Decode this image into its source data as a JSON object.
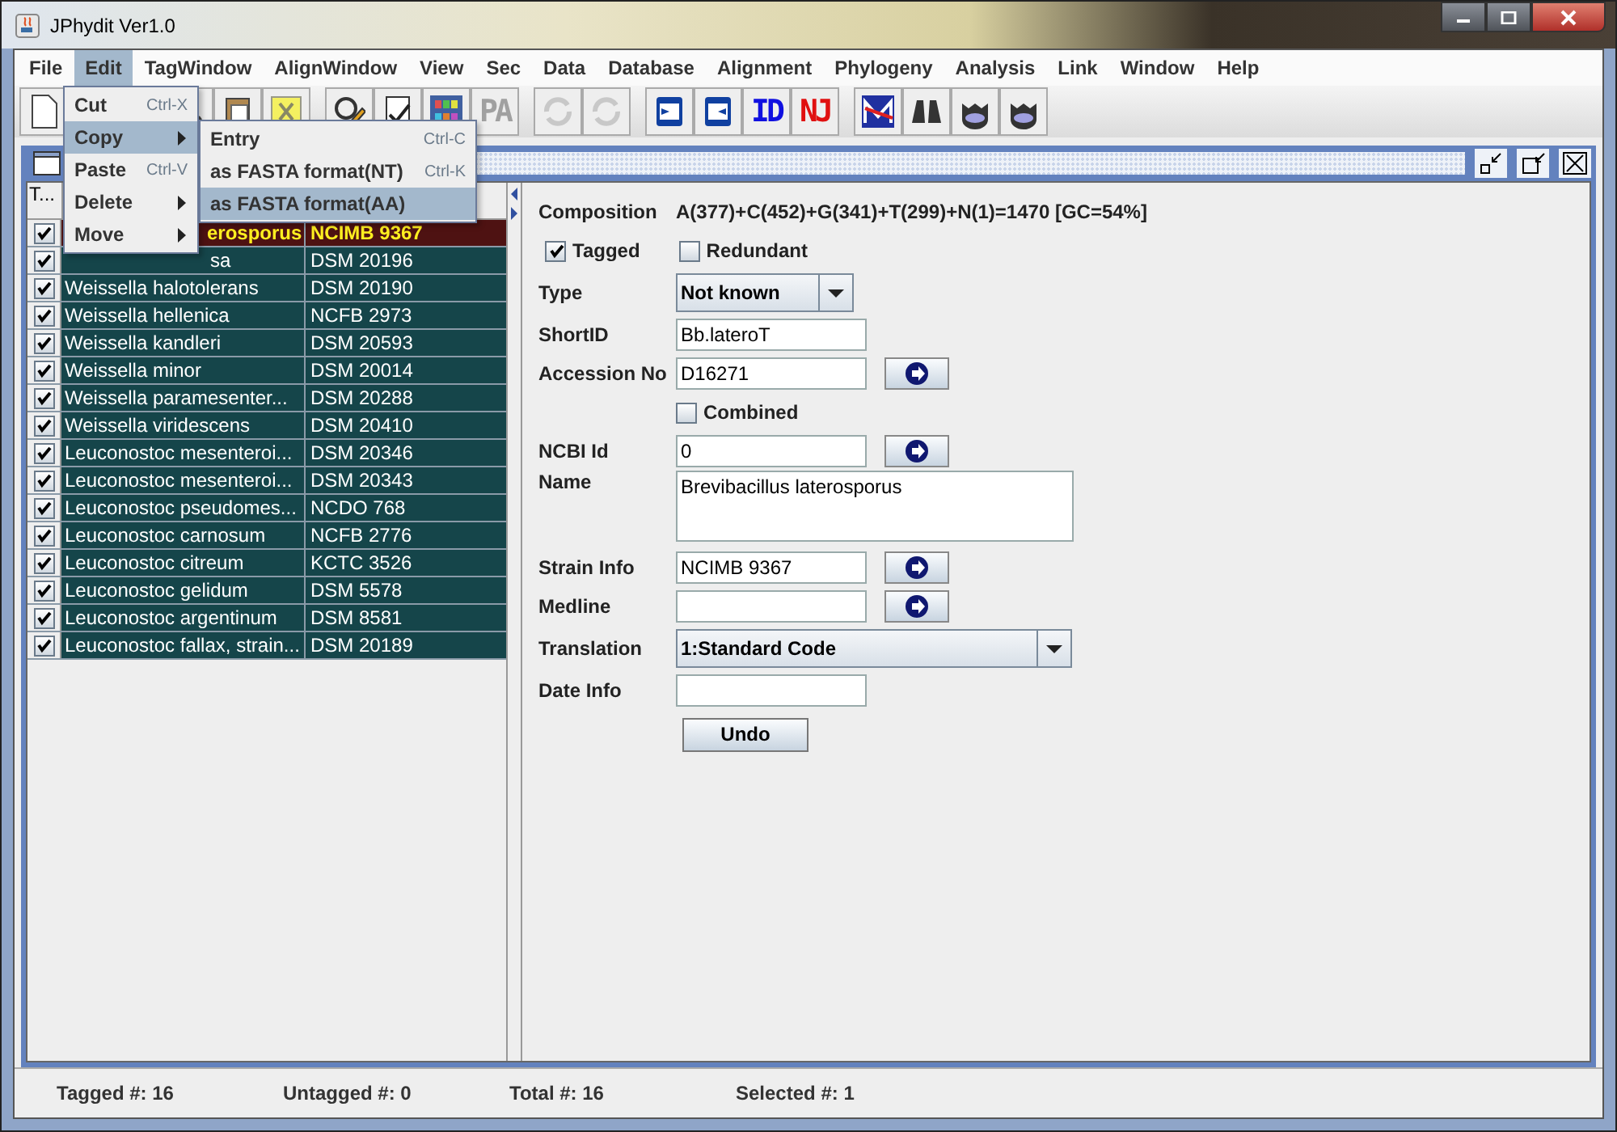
{
  "window": {
    "title": "JPhydit Ver1.0"
  },
  "menu": [
    {
      "label": "File",
      "selected": false
    },
    {
      "label": "Edit",
      "selected": true
    },
    {
      "label": "TagWindow",
      "selected": false
    },
    {
      "label": "AlignWindow",
      "selected": false
    },
    {
      "label": "View",
      "selected": false
    },
    {
      "label": "Sec",
      "selected": false
    },
    {
      "label": "Data",
      "selected": false
    },
    {
      "label": "Database",
      "selected": false
    },
    {
      "label": "Alignment",
      "selected": false
    },
    {
      "label": "Phylogeny",
      "selected": false
    },
    {
      "label": "Analysis",
      "selected": false
    },
    {
      "label": "Link",
      "selected": false
    },
    {
      "label": "Window",
      "selected": false
    },
    {
      "label": "Help",
      "selected": false
    }
  ],
  "edit_menu": [
    {
      "label": "Cut",
      "shortcut": "Ctrl-X",
      "submenu": false,
      "selected": false
    },
    {
      "label": "Copy",
      "submenu": true,
      "selected": true
    },
    {
      "label": "Paste",
      "shortcut": "Ctrl-V",
      "submenu": false,
      "selected": false
    },
    {
      "label": "Delete",
      "submenu": true,
      "selected": false
    },
    {
      "label": "Move",
      "submenu": true,
      "selected": false
    }
  ],
  "copy_submenu": [
    {
      "label": "Entry",
      "shortcut": "Ctrl-C",
      "selected": false
    },
    {
      "label": "as FASTA format(NT)",
      "shortcut": "Ctrl-K",
      "selected": false
    },
    {
      "label": "as FASTA format(AA)",
      "selected": true
    }
  ],
  "toolbar": [
    {
      "kind": "page"
    },
    {
      "kind": "scissors"
    },
    {
      "kind": "clipboard"
    },
    {
      "kind": "note"
    },
    {
      "kind": "edit"
    },
    {
      "kind": "tag"
    },
    {
      "kind": "grid"
    },
    {
      "kind": "text",
      "text": "PA",
      "color": "#a0a0a0"
    },
    {
      "kind": "refresh"
    },
    {
      "kind": "refresh"
    },
    {
      "kind": "import"
    },
    {
      "kind": "export"
    },
    {
      "kind": "text",
      "text": "ID",
      "color": "#1010e0"
    },
    {
      "kind": "text",
      "text": "NJ",
      "color": "#e01010"
    },
    {
      "kind": "chart"
    },
    {
      "kind": "binoculars"
    },
    {
      "kind": "face"
    },
    {
      "kind": "face"
    }
  ],
  "table": {
    "columns": [
      "T..."
    ],
    "rows": [
      {
        "tagged": true,
        "selected": true,
        "name": "erosporus",
        "id": "NCIMB 9367"
      },
      {
        "tagged": true,
        "selected": false,
        "name": "sa",
        "id": "DSM 20196"
      },
      {
        "tagged": true,
        "selected": false,
        "name": "Weissella halotolerans",
        "id": "DSM 20190"
      },
      {
        "tagged": true,
        "selected": false,
        "name": "Weissella hellenica",
        "id": "NCFB 2973"
      },
      {
        "tagged": true,
        "selected": false,
        "name": "Weissella kandleri",
        "id": "DSM 20593"
      },
      {
        "tagged": true,
        "selected": false,
        "name": "Weissella minor",
        "id": "DSM 20014"
      },
      {
        "tagged": true,
        "selected": false,
        "name": "Weissella paramesenter...",
        "id": "DSM 20288"
      },
      {
        "tagged": true,
        "selected": false,
        "name": "Weissella viridescens",
        "id": "DSM 20410"
      },
      {
        "tagged": true,
        "selected": false,
        "name": "Leuconostoc mesenteroi...",
        "id": "DSM 20346"
      },
      {
        "tagged": true,
        "selected": false,
        "name": "Leuconostoc mesenteroi...",
        "id": "DSM 20343"
      },
      {
        "tagged": true,
        "selected": false,
        "name": "Leuconostoc pseudomes...",
        "id": "NCDO 768"
      },
      {
        "tagged": true,
        "selected": false,
        "name": "Leuconostoc carnosum",
        "id": "NCFB 2776"
      },
      {
        "tagged": true,
        "selected": false,
        "name": "Leuconostoc citreum",
        "id": "KCTC 3526"
      },
      {
        "tagged": true,
        "selected": false,
        "name": "Leuconostoc gelidum",
        "id": "DSM 5578"
      },
      {
        "tagged": true,
        "selected": false,
        "name": "Leuconostoc argentinum",
        "id": "DSM 8581"
      },
      {
        "tagged": true,
        "selected": false,
        "name": "Leuconostoc fallax, strain...",
        "id": "DSM 20189"
      }
    ]
  },
  "detail": {
    "composition_label": "Composition",
    "composition": "A(377)+C(452)+G(341)+T(299)+N(1)=1470  [GC=54%]",
    "flags": [
      {
        "label": "Tagged",
        "checked": true
      },
      {
        "label": "Redundant",
        "checked": false
      }
    ],
    "fields": [
      {
        "kind": "combo",
        "label": "Type",
        "value": "Not known",
        "wide": false
      },
      {
        "kind": "text",
        "label": "ShortID",
        "value": "Bb.lateroT",
        "go": false
      },
      {
        "kind": "text",
        "label": "Accession No",
        "value": "D16271",
        "go": true
      },
      {
        "kind": "check",
        "label": "Combined",
        "checked": false
      },
      {
        "kind": "text",
        "label": "NCBI Id",
        "value": "0",
        "go": true
      },
      {
        "kind": "textarea",
        "label": "Name",
        "value": "Brevibacillus laterosporus"
      },
      {
        "kind": "text",
        "label": "Strain Info",
        "value": "NCIMB 9367",
        "go": true
      },
      {
        "kind": "text",
        "label": "Medline",
        "go": true
      },
      {
        "kind": "combo",
        "label": "Translation",
        "value": "1:Standard Code",
        "wide": true
      },
      {
        "kind": "text",
        "label": "Date Info",
        "go": false
      }
    ],
    "buttons": [
      "Undo"
    ]
  },
  "status_bar": [
    "Tagged #: 16",
    "Untagged #: 0",
    "Total #: 16",
    "Selected #: 1"
  ]
}
